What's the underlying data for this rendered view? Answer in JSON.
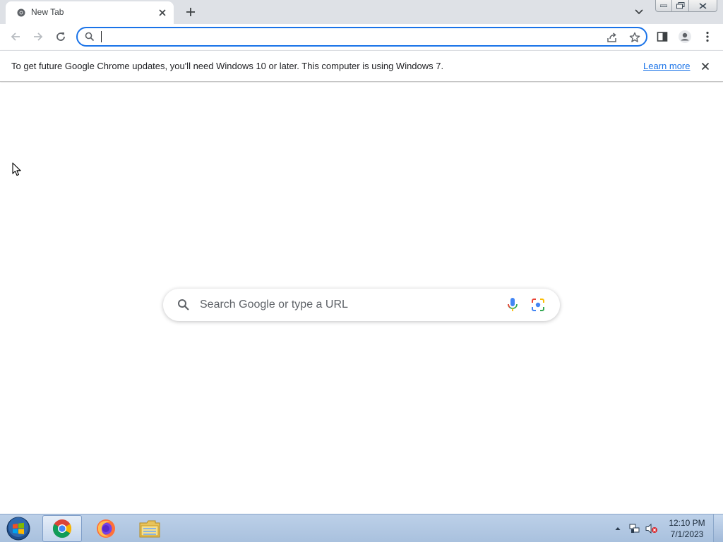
{
  "browser": {
    "tab": {
      "title": "New Tab"
    },
    "omnibox": {
      "value": "",
      "placeholder": ""
    },
    "infobar": {
      "message": "To get future Google Chrome updates, you'll need Windows 10 or later. This computer is using Windows 7.",
      "link": "Learn more"
    },
    "ntp_search": {
      "placeholder": "Search Google or type a URL"
    },
    "colors": {
      "accent": "#1a73e8",
      "tabstrip": "#dee1e6"
    }
  },
  "taskbar": {
    "items": [
      "chrome",
      "firefox",
      "file-explorer"
    ],
    "clock": {
      "time": "12:10 PM",
      "date": "7/1/2023"
    }
  }
}
